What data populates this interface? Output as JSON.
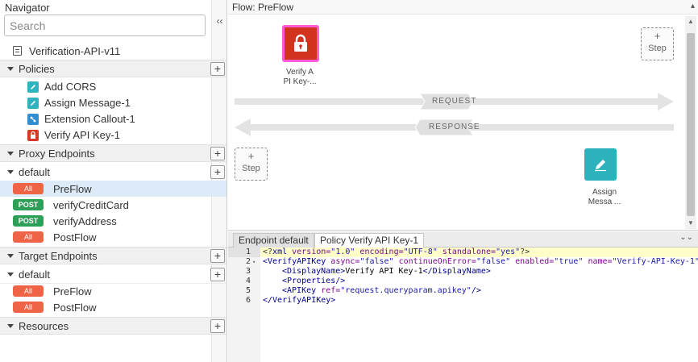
{
  "navigator": {
    "title": "Navigator",
    "search_placeholder": "Search",
    "collapse_label": "‹‹",
    "proxy_name": "Verification-API-v11",
    "policies": {
      "label": "Policies",
      "items": [
        {
          "label": "Add CORS",
          "icon": "edit-icon"
        },
        {
          "label": "Assign Message-1",
          "icon": "edit-icon"
        },
        {
          "label": "Extension Callout-1",
          "icon": "callout-icon"
        },
        {
          "label": "Verify API Key-1",
          "icon": "lock-icon"
        }
      ]
    },
    "proxy_endpoints": {
      "label": "Proxy Endpoints",
      "default_label": "default",
      "flows": [
        {
          "verb": "All",
          "label": "PreFlow",
          "selected": true
        },
        {
          "verb": "POST",
          "label": "verifyCreditCard"
        },
        {
          "verb": "POST",
          "label": "verifyAddress"
        },
        {
          "verb": "All",
          "label": "PostFlow"
        }
      ]
    },
    "target_endpoints": {
      "label": "Target Endpoints",
      "default_label": "default",
      "flows": [
        {
          "verb": "All",
          "label": "PreFlow"
        },
        {
          "verb": "All",
          "label": "PostFlow"
        }
      ]
    },
    "resources": {
      "label": "Resources"
    },
    "add_label": "+"
  },
  "flow": {
    "title": "Flow: PreFlow",
    "request_label": "REQUEST",
    "response_label": "RESPONSE",
    "step_plus": "+",
    "step_label": "Step",
    "request_policy": {
      "caption_line1": "Verify A",
      "caption_line2": "PI Key-...",
      "icon": "lock-icon"
    },
    "response_policy": {
      "caption_line1": "Assign",
      "caption_line2": "Messa ...",
      "icon": "edit-icon"
    }
  },
  "editor": {
    "tabs": [
      {
        "label": "Endpoint default",
        "active": false
      },
      {
        "label": "Policy Verify API Key-1",
        "active": true
      }
    ],
    "line_numbers": [
      "1",
      "2",
      "3",
      "4",
      "5",
      "6"
    ],
    "code": {
      "l1_pi_open": "<?",
      "l1_name": "xml",
      "l1_a1": " version=",
      "l1_v1": "\"1.0\"",
      "l1_a2": " encoding=",
      "l1_v2": "\"UTF-8\"",
      "l1_a3": " standalone=",
      "l1_v3": "\"yes\"",
      "l1_pi_close": "?>",
      "l2_tag": "<VerifyAPIKey",
      "l2_a1": " async=",
      "l2_v1": "\"false\"",
      "l2_a2": " continueOnError=",
      "l2_v2": "\"false\"",
      "l2_a3": " enabled=",
      "l2_v3": "\"true\"",
      "l2_a4": " name=",
      "l2_v4": "\"Verify-API-Key-1\"",
      "l3_open": "<DisplayName>",
      "l3_text": "Verify API Key-1",
      "l3_close": "</DisplayName>",
      "l4_tag": "<Properties/>",
      "l5_tag": "<APIKey",
      "l5_a1": " ref=",
      "l5_v1": "\"request.queryparam.apikey\"",
      "l5_close": "/>",
      "l6_tag": "</VerifyAPIKey>"
    }
  },
  "colors": {
    "verb_all": "#ef6447",
    "verb_post": "#2e9f57",
    "selected_row": "#dcebf7",
    "policy_red": "#d1331f",
    "policy_teal": "#2cb2bb",
    "selection_outline": "#ff5bd9"
  }
}
